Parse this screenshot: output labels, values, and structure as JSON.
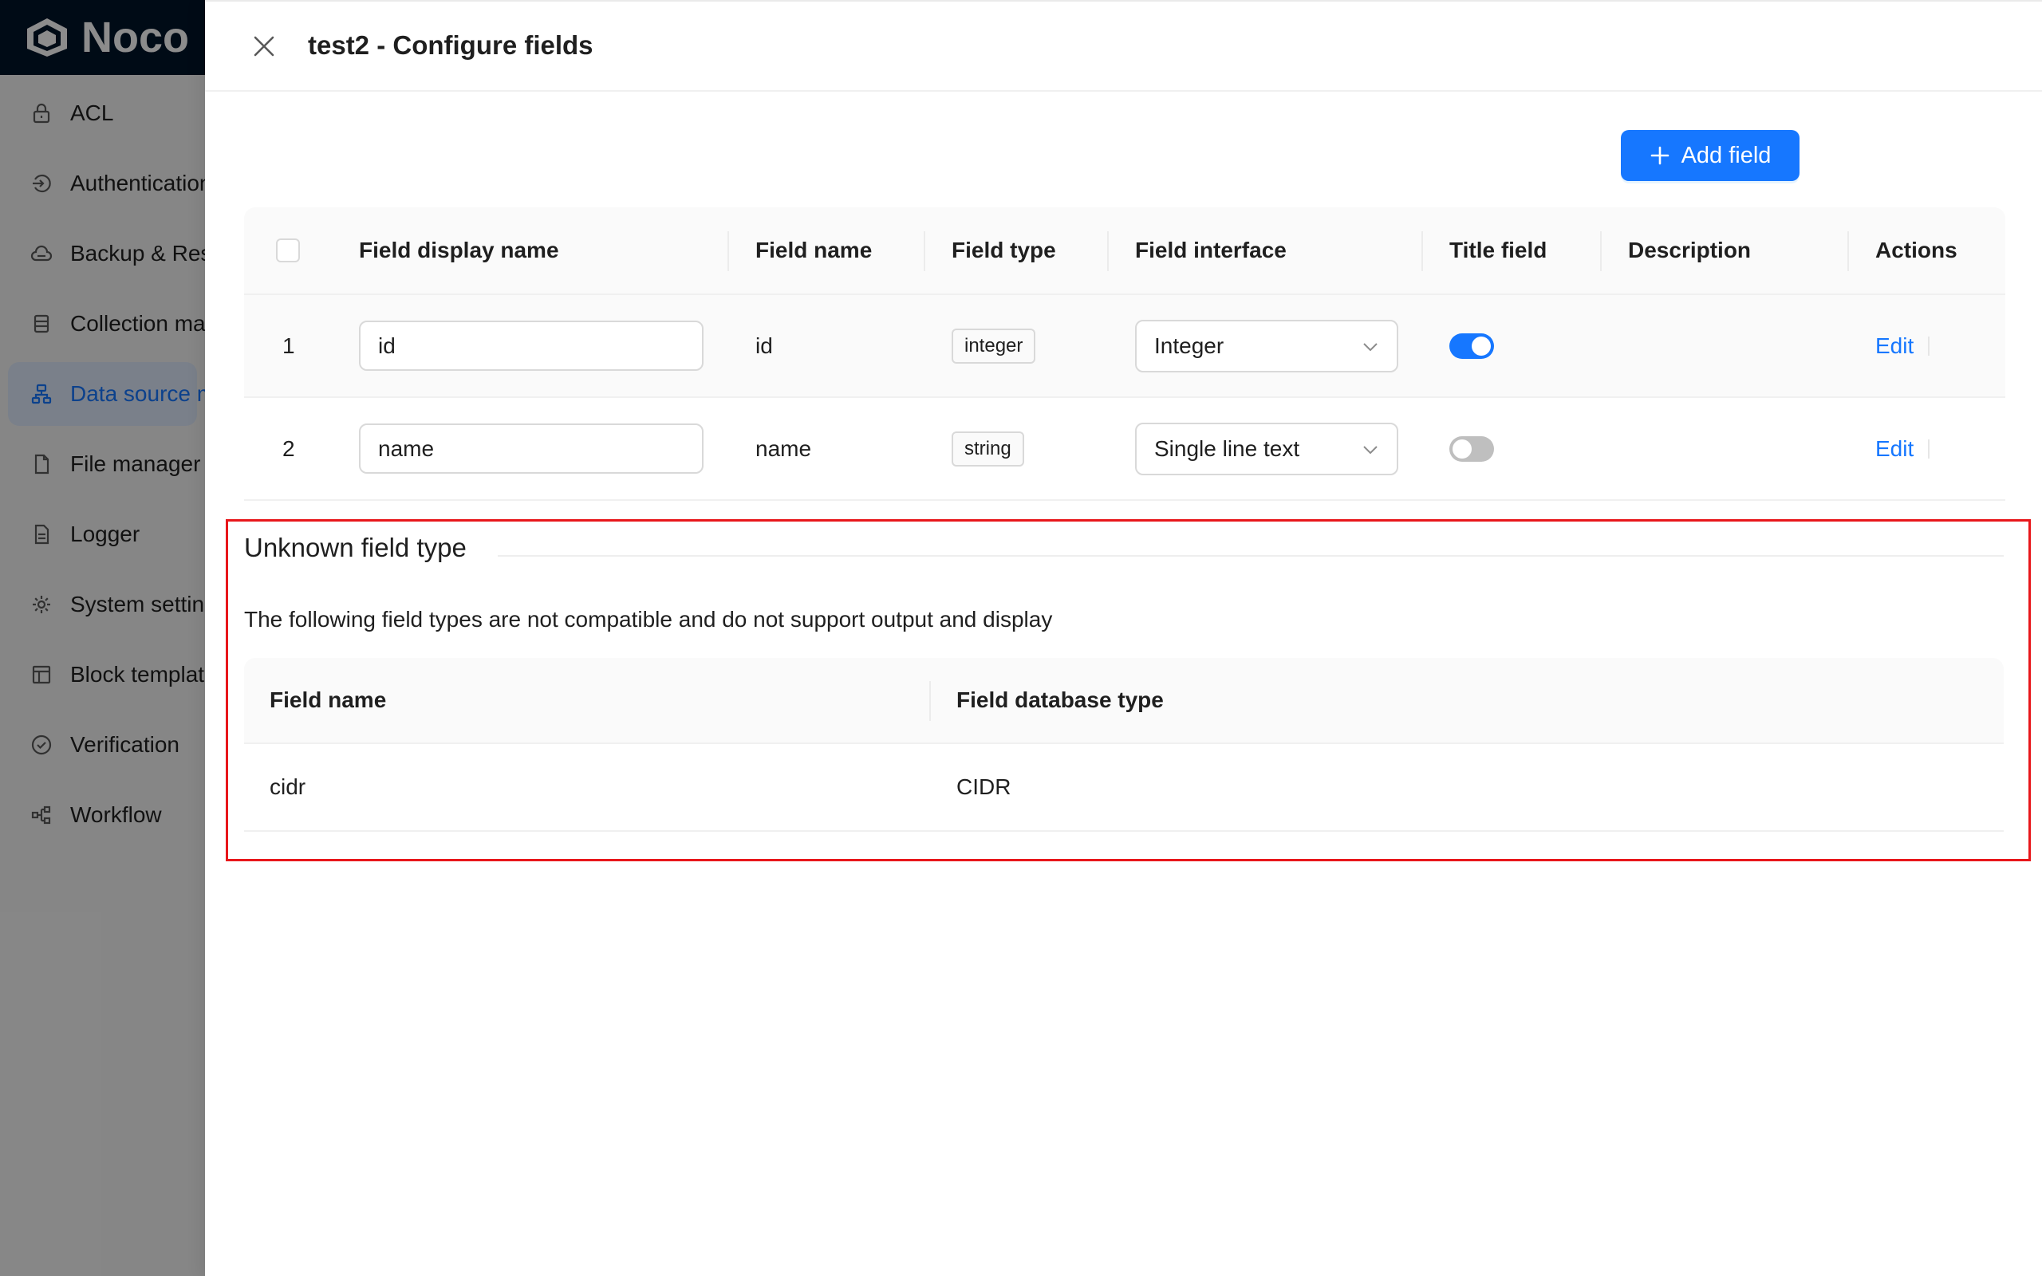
{
  "app": {
    "logo_text": "Noco"
  },
  "sidebar": {
    "items": [
      {
        "label": "ACL",
        "icon": "lock-icon"
      },
      {
        "label": "Authentication",
        "icon": "login-icon"
      },
      {
        "label": "Backup & Restore",
        "icon": "cloud-server-icon"
      },
      {
        "label": "Collection manager",
        "icon": "database-icon"
      },
      {
        "label": "Data source manager",
        "icon": "cluster-icon",
        "active": true
      },
      {
        "label": "File manager",
        "icon": "file-icon"
      },
      {
        "label": "Logger",
        "icon": "file-text-icon"
      },
      {
        "label": "System settings",
        "icon": "gear-icon"
      },
      {
        "label": "Block templates",
        "icon": "layout-icon"
      },
      {
        "label": "Verification",
        "icon": "check-circle-icon"
      },
      {
        "label": "Workflow",
        "icon": "workflow-icon"
      }
    ]
  },
  "drawer": {
    "title": "test2 - Configure fields",
    "add_field_label": "Add field"
  },
  "fields_table": {
    "columns": [
      "Field display name",
      "Field name",
      "Field type",
      "Field interface",
      "Title field",
      "Description",
      "Actions"
    ],
    "rows": [
      {
        "index": "1",
        "display_name": "id",
        "name": "id",
        "type": "integer",
        "interface": "Integer",
        "title_field": true,
        "description": "",
        "action": "Edit"
      },
      {
        "index": "2",
        "display_name": "name",
        "name": "name",
        "type": "string",
        "interface": "Single line text",
        "title_field": false,
        "description": "",
        "action": "Edit"
      }
    ]
  },
  "unknown_section": {
    "title": "Unknown field type",
    "description": "The following field types are not compatible and do not support output and display",
    "columns": [
      "Field name",
      "Field database type"
    ],
    "rows": [
      {
        "field_name": "cidr",
        "db_type": "CIDR"
      }
    ]
  },
  "colors": {
    "primary": "#1677ff",
    "highlight_border": "#e8171b",
    "logo_bar": "#001529"
  }
}
